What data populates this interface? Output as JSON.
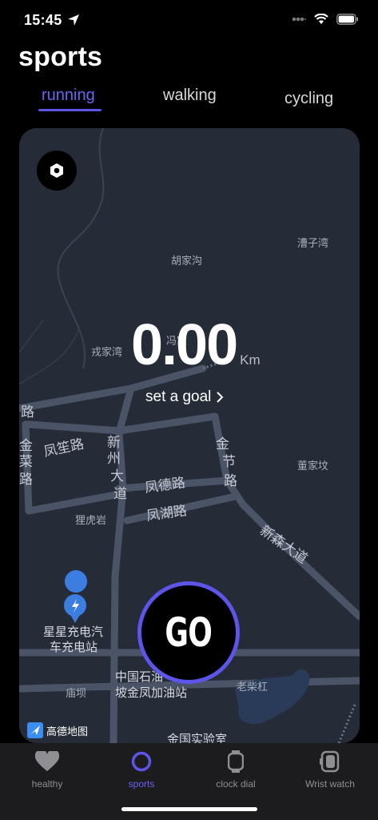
{
  "status": {
    "time": "15:45"
  },
  "title": "sports",
  "tabs": [
    {
      "label": "running",
      "active": true
    },
    {
      "label": "walking",
      "active": false
    },
    {
      "label": "cycling",
      "active": false
    }
  ],
  "workout": {
    "distance": "0.00",
    "unit": "Km",
    "goal_label": "set a goal",
    "go_label": "GO"
  },
  "map": {
    "places": [
      "胡家沟",
      "漕子湾",
      "戎家湾",
      "冯家",
      "董家坟",
      "狸虎岩",
      "庙坝",
      "老柴杠"
    ],
    "roads": [
      "凤笙路",
      "凤德路",
      "凤湖路",
      "新州大道",
      "金节路",
      "新森大道",
      "金"
    ],
    "pois": [
      "星星充电汽车充电站",
      "中国石油",
      "坡金凤加油站",
      "金国实验室"
    ],
    "provider": "高德地图"
  },
  "tabbar": [
    {
      "label": "healthy",
      "icon": "heart-icon",
      "active": false
    },
    {
      "label": "sports",
      "icon": "ring-icon",
      "active": true
    },
    {
      "label": "clock dial",
      "icon": "watch-icon",
      "active": false
    },
    {
      "label": "Wrist watch",
      "icon": "watch-side-icon",
      "active": false
    }
  ],
  "colors": {
    "accent": "#5d55ea",
    "map_bg": "#252c38",
    "road": "#4a5466"
  }
}
